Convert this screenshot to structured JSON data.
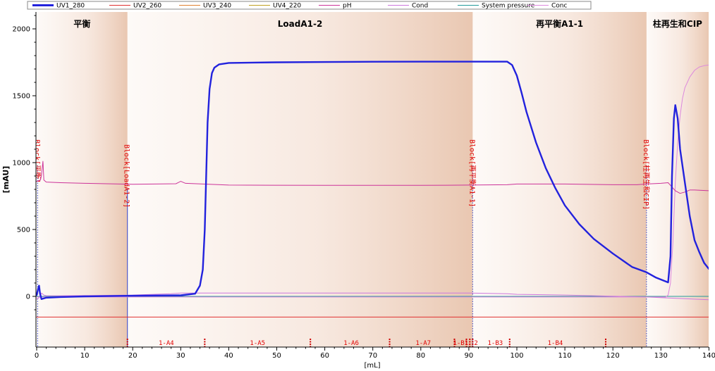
{
  "chart_data": {
    "type": "line",
    "xlabel": "[mL]",
    "ylabel": "[mAU]",
    "xlim": [
      0,
      140
    ],
    "ylim": [
      -190,
      2110
    ],
    "x_ticks": [
      0,
      10,
      20,
      30,
      40,
      50,
      60,
      70,
      80,
      90,
      100,
      110,
      120,
      130,
      140
    ],
    "y_ticks": [
      0,
      500,
      1000,
      1500,
      2000
    ],
    "grid": false,
    "legend_position": "top",
    "legend": [
      {
        "name": "UV1_280",
        "color": "#2222dd",
        "bold": true
      },
      {
        "name": "UV2_260",
        "color": "#e03030"
      },
      {
        "name": "UV3_240",
        "color": "#e08030"
      },
      {
        "name": "UV4_220",
        "color": "#c0a020"
      },
      {
        "name": "pH",
        "color": "#cc3399"
      },
      {
        "name": "Cond",
        "color": "#cc77dd"
      },
      {
        "name": "System pressure",
        "color": "#229999"
      },
      {
        "name": "Conc",
        "color": "#dd88dd"
      }
    ],
    "phases": [
      {
        "label": "平衡",
        "start": 0,
        "end": 18.9
      },
      {
        "label": "LoadA1-2",
        "start": 18.9,
        "end": 90.8
      },
      {
        "label": "再平衡A1-1",
        "start": 90.8,
        "end": 127
      },
      {
        "label": "柱再生和CIP",
        "start": 127,
        "end": 140
      }
    ],
    "blocks": [
      {
        "label": "Block[平衡]",
        "x": 0.2
      },
      {
        "label": "Block[LoadA1-2]",
        "x": 18.9
      },
      {
        "label": "Block[再平衡A1-1]",
        "x": 90.8
      },
      {
        "label": "Block[柱再生和CIP]",
        "x": 127
      }
    ],
    "fraction_marks": [
      18.9,
      35,
      57,
      73.5,
      87,
      89.5,
      90.2,
      90.8,
      98.5,
      118.5
    ],
    "fraction_labels": [
      {
        "label": "1-A4",
        "x": 27
      },
      {
        "label": "1-A5",
        "x": 46
      },
      {
        "label": "1-A6",
        "x": 65.5
      },
      {
        "label": "1-A7",
        "x": 80.5
      },
      {
        "label": "1-B1",
        "x": 88.3
      },
      {
        "label": "2",
        "x": 91.5
      },
      {
        "label": "1-B3",
        "x": 95.5
      },
      {
        "label": "1-B4",
        "x": 108
      }
    ],
    "series": [
      {
        "name": "UV1_280",
        "color": "#2222dd",
        "width": 2.4,
        "x": [
          0,
          0.3,
          0.5,
          0.7,
          1,
          2,
          5,
          10,
          20,
          30,
          33,
          34,
          34.6,
          35,
          35.3,
          35.6,
          36,
          36.5,
          37,
          38,
          40,
          45,
          50,
          60,
          70,
          80,
          90,
          95,
          98,
          99,
          100,
          101,
          102,
          104,
          106,
          108,
          110,
          113,
          116,
          120,
          124,
          127,
          129,
          131.5,
          132,
          132.3,
          132.7,
          133,
          133.5,
          134,
          135,
          136,
          137,
          138,
          139,
          140
        ],
        "y": [
          10,
          55,
          80,
          20,
          -20,
          -10,
          -5,
          0,
          5,
          8,
          20,
          80,
          200,
          500,
          900,
          1300,
          1550,
          1670,
          1710,
          1735,
          1745,
          1748,
          1750,
          1752,
          1754,
          1755,
          1755,
          1755,
          1755,
          1730,
          1650,
          1520,
          1380,
          1150,
          960,
          810,
          680,
          540,
          430,
          320,
          220,
          180,
          140,
          105,
          300,
          900,
          1330,
          1430,
          1330,
          1100,
          850,
          600,
          420,
          330,
          250,
          205
        ]
      },
      {
        "name": "pH",
        "color": "#cc3399",
        "width": 1,
        "x": [
          0,
          0.8,
          1,
          1.3,
          1.5,
          2,
          5,
          10,
          20,
          29,
          30,
          31,
          40,
          60,
          80,
          90,
          98,
          100,
          110,
          120,
          125,
          127,
          130,
          131.5,
          132,
          133,
          134,
          135,
          136,
          137,
          140
        ],
        "y": [
          860,
          870,
          905,
          1010,
          870,
          855,
          850,
          845,
          838,
          842,
          860,
          845,
          832,
          830,
          830,
          832,
          835,
          840,
          840,
          835,
          835,
          840,
          845,
          850,
          830,
          790,
          770,
          780,
          795,
          795,
          790
        ]
      },
      {
        "name": "Conc",
        "color": "#dd88dd",
        "width": 1,
        "x": [
          0,
          131,
          131.5,
          132,
          132.5,
          133,
          133.5,
          134,
          134.5,
          135,
          136,
          137,
          138,
          139,
          140
        ],
        "y": [
          -5,
          -5,
          10,
          100,
          400,
          850,
          1150,
          1350,
          1480,
          1560,
          1640,
          1690,
          1715,
          1725,
          1730
        ]
      },
      {
        "name": "Cond",
        "color": "#cc77dd",
        "width": 1,
        "x": [
          0,
          0.5,
          1,
          1.5,
          2,
          5,
          20,
          28,
          30,
          90,
          98,
          100,
          110,
          127,
          140
        ],
        "y": [
          -20,
          -10,
          25,
          10,
          5,
          5,
          10,
          20,
          25,
          25,
          20,
          15,
          10,
          -5,
          -25
        ]
      },
      {
        "name": "System pressure",
        "color": "#229999",
        "width": 1,
        "x": [
          0,
          140
        ],
        "y": [
          0,
          0
        ]
      },
      {
        "name": "UV2_260",
        "color": "#e03030",
        "width": 1,
        "x": [
          0,
          140
        ],
        "y": [
          -155,
          -155
        ]
      }
    ]
  }
}
